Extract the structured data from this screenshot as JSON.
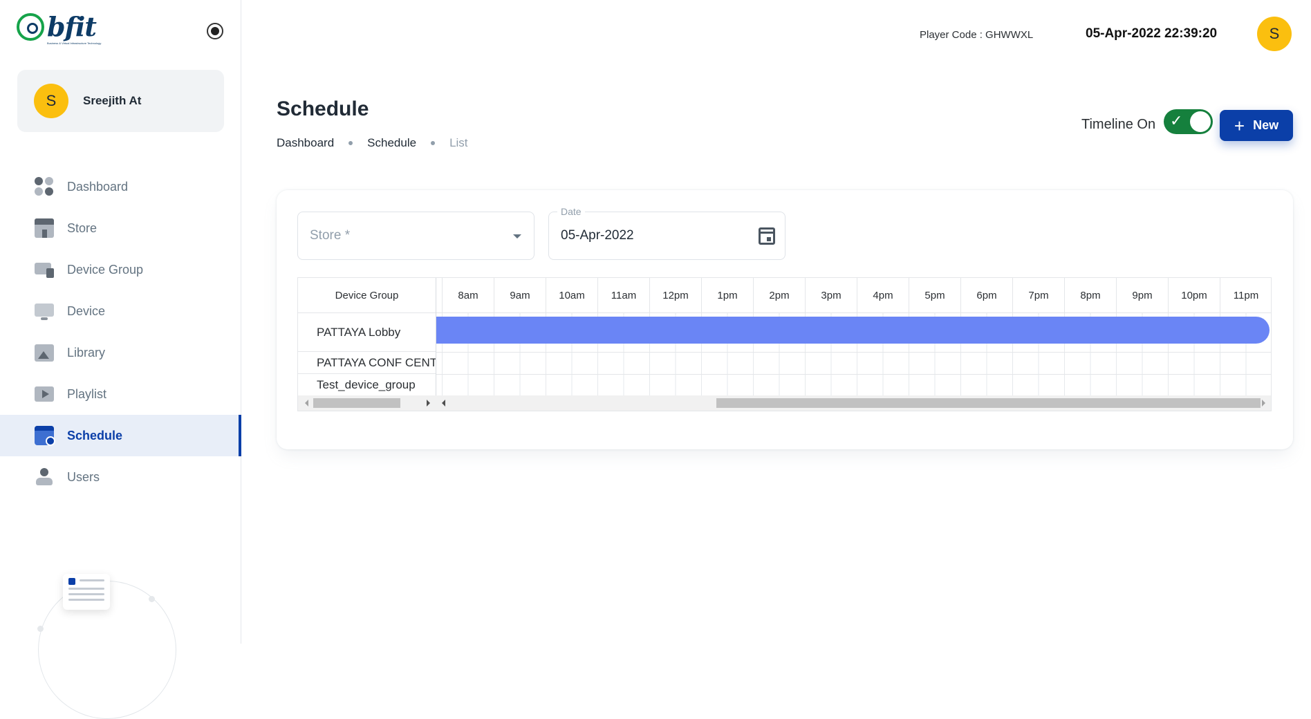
{
  "brand": {
    "name": "bfit",
    "tagline": "Business & Virtual Infrastructure Technology"
  },
  "user": {
    "initial": "S",
    "name": "Sreejith At"
  },
  "nav": [
    {
      "label": "Dashboard",
      "icon": "dashboard-icon"
    },
    {
      "label": "Store",
      "icon": "store-icon"
    },
    {
      "label": "Device Group",
      "icon": "device-group-icon"
    },
    {
      "label": "Device",
      "icon": "device-icon"
    },
    {
      "label": "Library",
      "icon": "library-icon"
    },
    {
      "label": "Playlist",
      "icon": "playlist-icon"
    },
    {
      "label": "Schedule",
      "icon": "schedule-icon",
      "active": true
    },
    {
      "label": "Users",
      "icon": "users-icon"
    }
  ],
  "topbar": {
    "player_code": "Player Code : GHWWXL",
    "datetime": "05-Apr-2022 22:39:20",
    "avatar_initial": "S"
  },
  "header": {
    "title": "Schedule",
    "breadcrumb": [
      "Dashboard",
      "Schedule",
      "List"
    ],
    "timeline_label": "Timeline On",
    "timeline_on": true,
    "new_button": "New"
  },
  "filters": {
    "store_placeholder": "Store *",
    "date_label": "Date",
    "date_value": "05-Apr-2022"
  },
  "timeline": {
    "group_header": "Device Group",
    "hours": [
      "8am",
      "9am",
      "10am",
      "11am",
      "12pm",
      "1pm",
      "2pm",
      "3pm",
      "4pm",
      "5pm",
      "6pm",
      "7pm",
      "8pm",
      "9pm",
      "10pm",
      "11pm"
    ],
    "groups": [
      "PATTAYA Lobby",
      "PATTAYA CONF CENTER",
      "Test_device_group"
    ],
    "events": [
      {
        "group": "PATTAYA Lobby",
        "color": "#6a85f5"
      }
    ]
  },
  "colors": {
    "primary": "#0b3fa8",
    "toggle_on": "#15803d",
    "avatar": "#fbbf0f",
    "event": "#6a85f5"
  }
}
